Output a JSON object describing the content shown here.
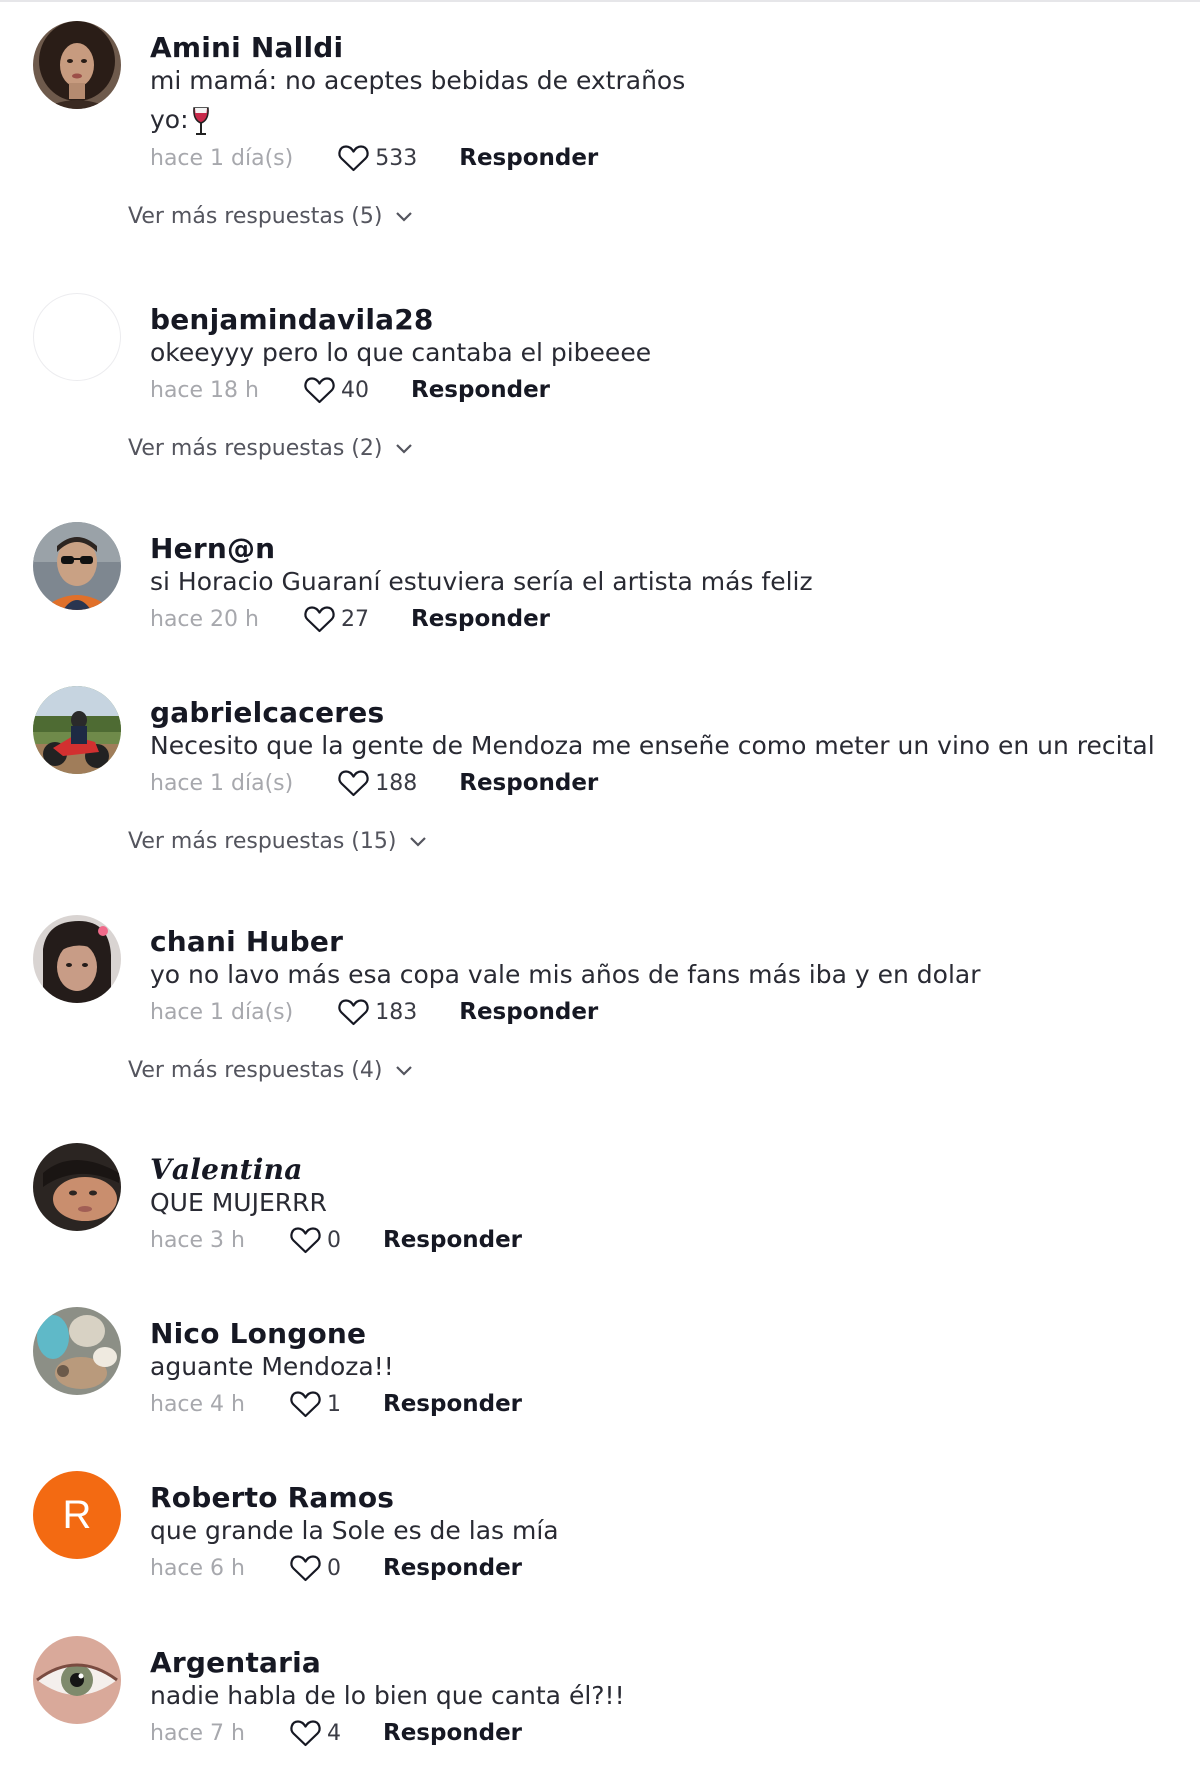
{
  "reply_label": "Responder",
  "comments": [
    {
      "user": "Amini Nalldi",
      "lines": [
        "mi mamá: no aceptes bebidas de extraños",
        "yo:"
      ],
      "time": "hace 1 día(s)",
      "likes": "533",
      "more": "Ver más respuestas (5)",
      "avatar": "photo-woman-curly-hair"
    },
    {
      "user": "benjamindavila28",
      "lines": [
        "okeeyyy pero lo que cantaba el pibeeee"
      ],
      "time": "hace 18 h",
      "likes": "40",
      "more": "Ver más respuestas (2)",
      "avatar": "blank"
    },
    {
      "user": "Hern@n",
      "lines": [
        "si Horacio Guaraní estuviera sería el artista más feliz"
      ],
      "time": "hace 20 h",
      "likes": "27",
      "avatar": "photo-man-sunglasses"
    },
    {
      "user": "gabrielcaceres",
      "lines": [
        "Necesito que la gente de Mendoza me enseñe como meter un vino en un recital"
      ],
      "time": "hace 1 día(s)",
      "likes": "188",
      "more": "Ver más respuestas (15)",
      "avatar": "photo-motorcycle"
    },
    {
      "user": "chani Huber",
      "lines": [
        "yo no lavo más esa copa vale mis años de fans más iba y en dolar"
      ],
      "time": "hace 1 día(s)",
      "likes": "183",
      "more": "Ver más respuestas (4)",
      "avatar": "photo-woman-bangs"
    },
    {
      "user": "𝑽𝒂𝒍𝒆𝒏𝒕𝒊𝒏𝒂",
      "lines": [
        "QUE MUJERRR"
      ],
      "time": "hace 3 h",
      "likes": "0",
      "avatar": "photo-woman-face"
    },
    {
      "user": "Nico Longone",
      "lines": [
        "aguante Mendoza!!"
      ],
      "time": "hace 4 h",
      "likes": "1",
      "avatar": "photo-objects"
    },
    {
      "user": "Roberto Ramos",
      "lines": [
        "que grande la Sole es de las mía"
      ],
      "time": "hace 6 h",
      "likes": "0",
      "avatar": "letter",
      "avatar_letter": "R"
    },
    {
      "user": "Argentaria",
      "lines": [
        "nadie habla de lo bien que canta él?!!"
      ],
      "time": "hace 7 h",
      "likes": "4",
      "avatar": "photo-eye"
    }
  ],
  "colors": {
    "avatar_letter_bg": "#f36a12",
    "text": "#161823",
    "muted": "#a7a8ad"
  },
  "emoji": "wine-glass"
}
